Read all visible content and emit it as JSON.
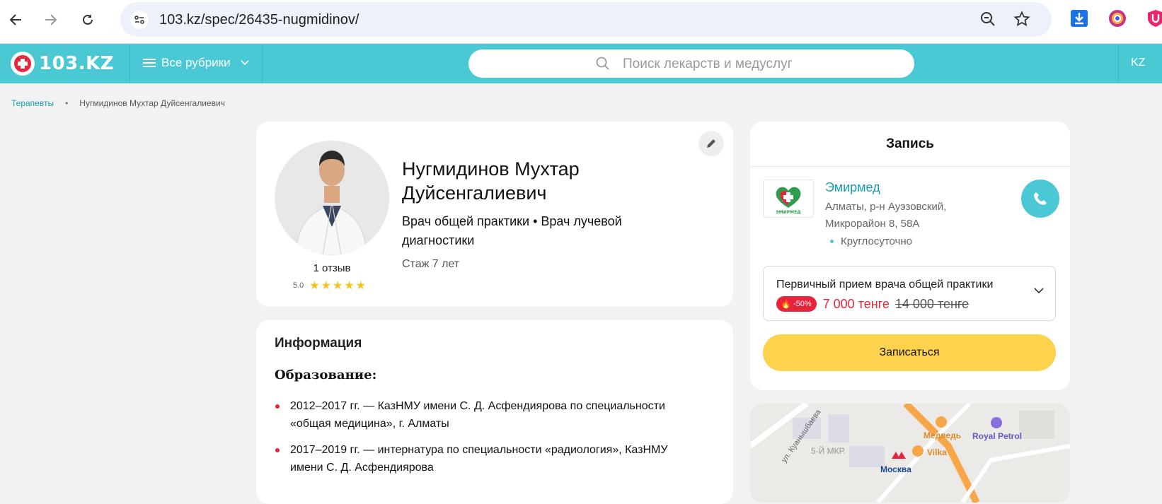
{
  "browser": {
    "url": "103.kz/spec/26435-nugmidinov/"
  },
  "header": {
    "logo_text": "103.KZ",
    "rubrics_label": "Все рубрики",
    "search_placeholder": "Поиск лекарств и медуслуг",
    "lang": "KZ"
  },
  "breadcrumb": {
    "parent": "Терапевты",
    "current": "Нугмидинов Мухтар Дуйсенгалиевич"
  },
  "profile": {
    "name": "Нугмидинов Мухтар Дуйсенгалиевич",
    "specialty": "Врач общей практики • Врач лучевой диагностики",
    "experience": "Стаж 7 лет",
    "reviews": "1 отзыв",
    "rating": "5.0",
    "stars": 5
  },
  "info": {
    "title": "Информация",
    "education_title": "Образование:",
    "education": [
      "2012–2017 гг. — КазНМУ имени С. Д. Асфендиярова по специальности «общая медицина», г. Алматы",
      "2017–2019 гг. — интернатура по специальности «радиология», КазНМУ имени С. Д. Асфендиярова"
    ]
  },
  "booking": {
    "title": "Запись",
    "clinic_logo_text": "ЭМИРМЕД",
    "clinic_name": "Эмирмед",
    "clinic_address": "Алматы, р-н Ауэзовский, Микрорайон 8, 58А",
    "clinic_hours": "Круглосуточно",
    "service_name": "Первичный прием врача общей практики",
    "discount": "-50%",
    "new_price": "7 000 тенге",
    "old_price": "14 000 тенге",
    "book_label": "Записаться"
  },
  "map": {
    "labels": [
      "ул. Куанышбаева",
      "5-Й МКР.",
      "Медведь",
      "Vilka",
      "Москва",
      "Royal Petrol"
    ]
  },
  "colors": {
    "brand": "#4ac9d4",
    "accent_red": "#e8243c",
    "button_yellow": "#fdd34d",
    "link": "#1a9eaa"
  }
}
